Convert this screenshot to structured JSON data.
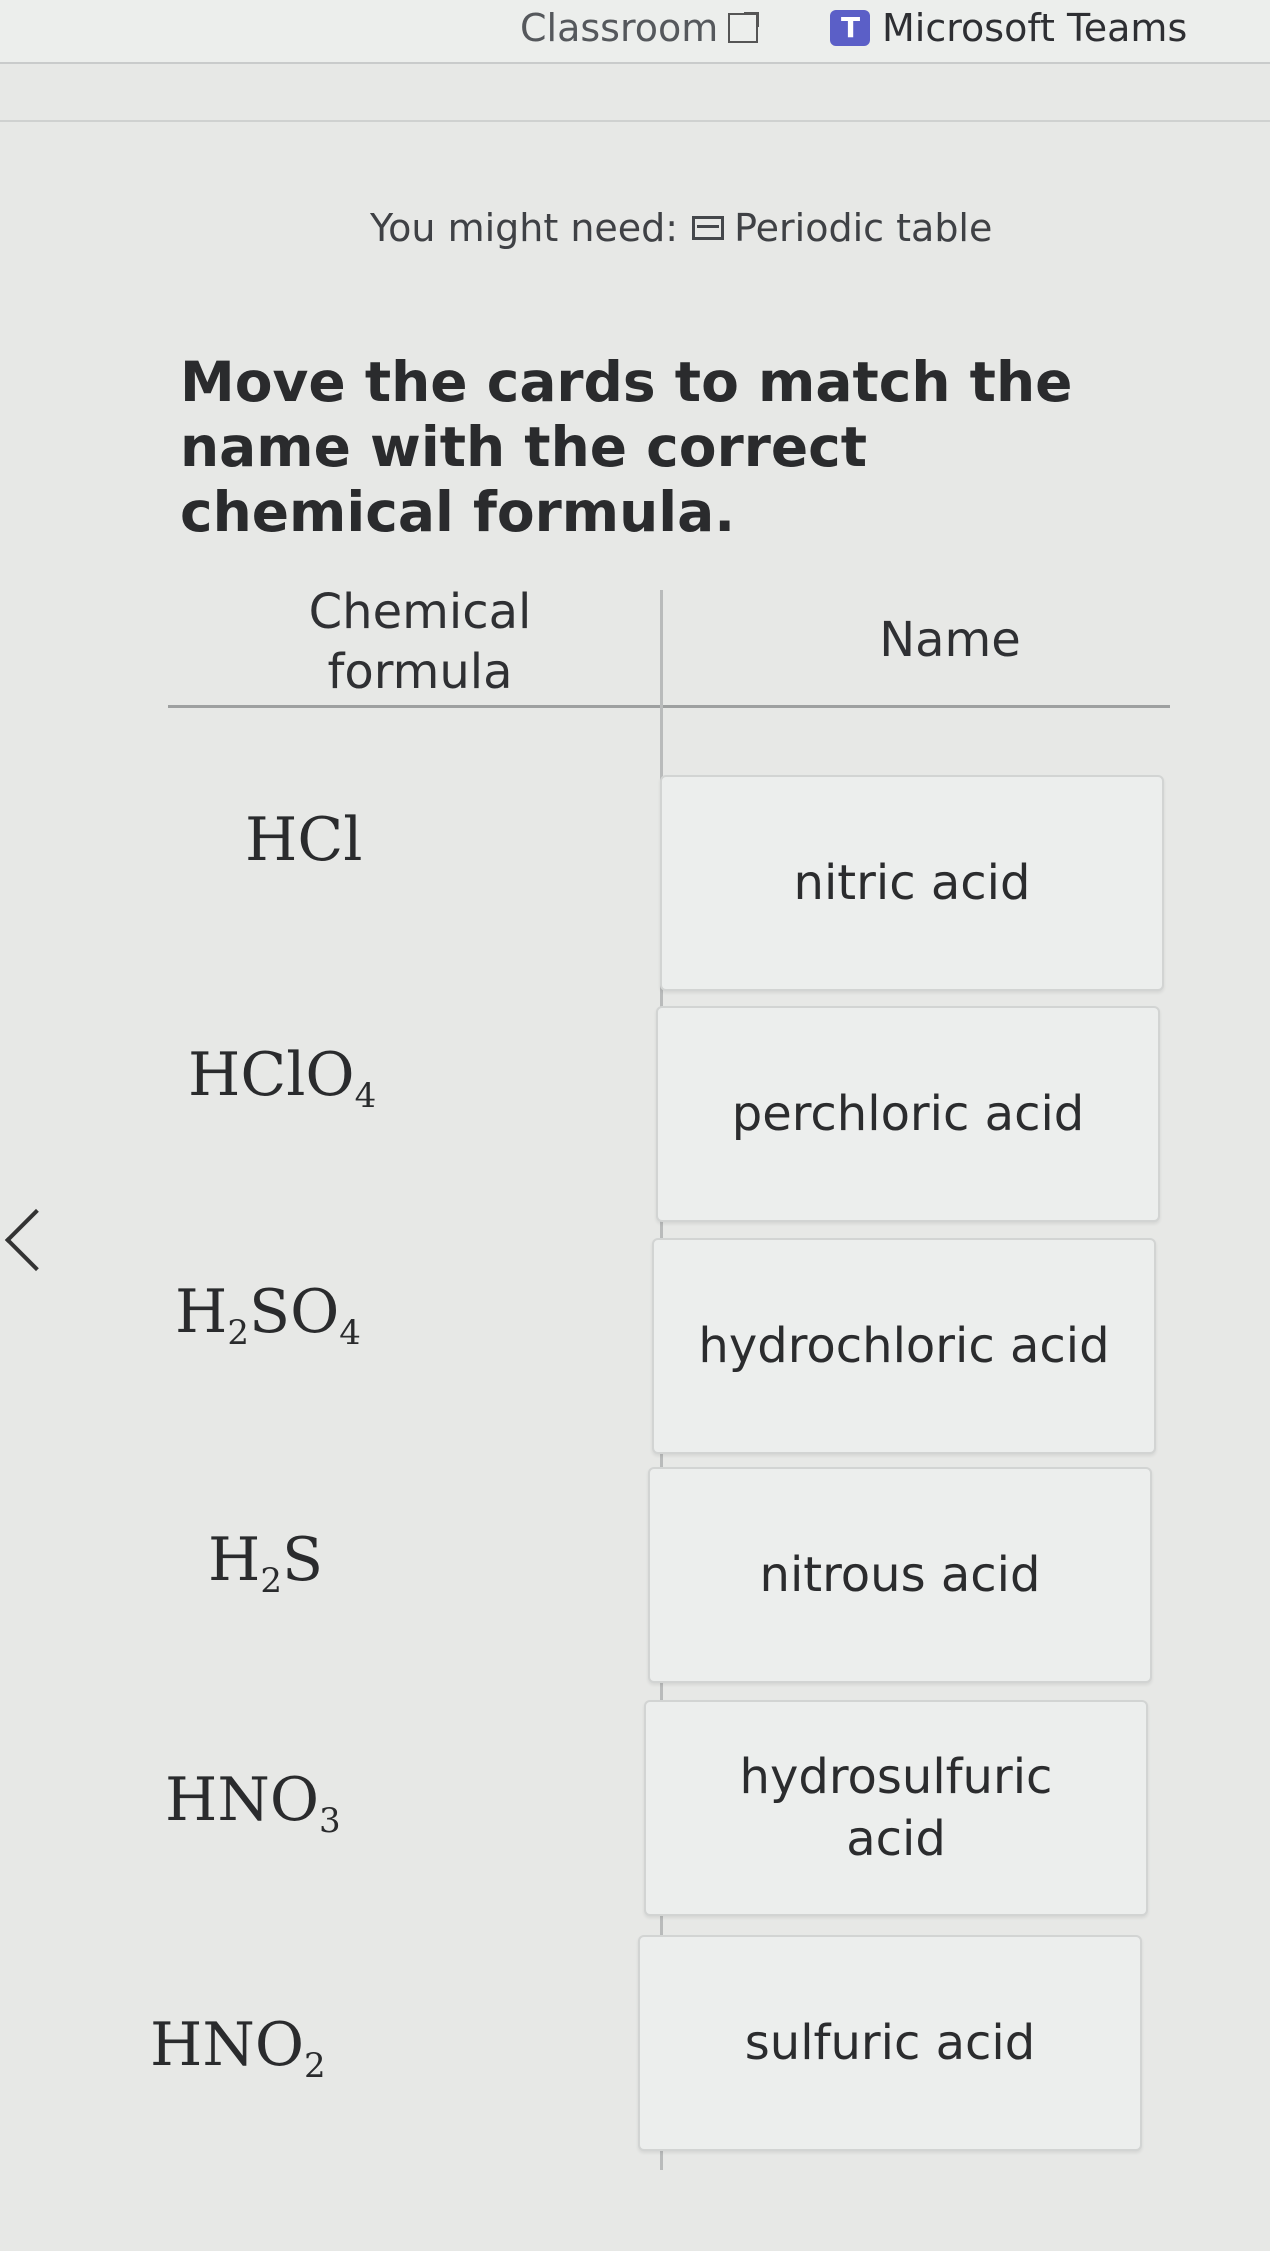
{
  "browser": {
    "bookmarks": [
      {
        "label": "Classroom"
      },
      {
        "label": "Microsoft Teams"
      }
    ]
  },
  "question": {
    "might_need_label": "You might need:",
    "periodic_table_label": "Periodic table",
    "prompt": "Move the cards to match the name with the correct chemical formula."
  },
  "table": {
    "formula_header": "Chemical formula",
    "name_header": "Name",
    "formulas": [
      {
        "base": "HCl",
        "parts": [
          {
            "t": "HCl",
            "sub": ""
          }
        ]
      },
      {
        "base": "HClO",
        "parts": [
          {
            "t": "HClO",
            "sub": "4"
          }
        ]
      },
      {
        "base": "H2SO4",
        "parts": [
          {
            "t": "H",
            "sub": "2"
          },
          {
            "t": "SO",
            "sub": "4"
          }
        ]
      },
      {
        "base": "H2S",
        "parts": [
          {
            "t": "H",
            "sub": "2"
          },
          {
            "t": "S",
            "sub": ""
          }
        ]
      },
      {
        "base": "HNO3",
        "parts": [
          {
            "t": "HNO",
            "sub": "3"
          }
        ]
      },
      {
        "base": "HNO2",
        "parts": [
          {
            "t": "HNO",
            "sub": "2"
          }
        ]
      }
    ],
    "name_cards": [
      "nitric acid",
      "perchloric acid",
      "hydrochloric acid",
      "nitrous acid",
      "hydrosulfuric acid",
      "sulfuric acid"
    ]
  }
}
